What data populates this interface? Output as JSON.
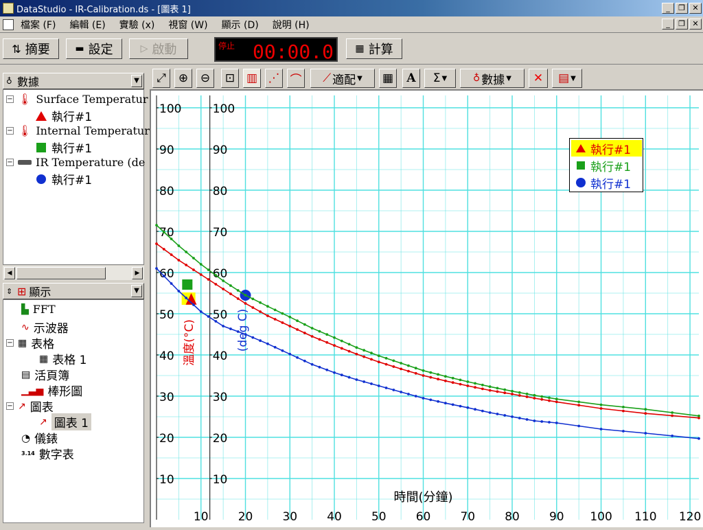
{
  "window": {
    "title": "DataStudio - IR-Calibration.ds - [圖表 1]"
  },
  "menu": {
    "items": [
      "檔案 (F)",
      "編輯 (E)",
      "實驗 (x)",
      "視窗 (W)",
      "顯示 (D)",
      "說明 (H)"
    ]
  },
  "toolbar": {
    "summary": "摘要",
    "setup": "設定",
    "start": "啟動",
    "status": "停止",
    "time": "00:00.0",
    "calculate": "計算"
  },
  "data_panel": {
    "header": "數據",
    "items": [
      {
        "label": "Surface Temperatur",
        "run": "執行#1"
      },
      {
        "label": "Internal Temperatur",
        "run": "執行#1"
      },
      {
        "label": "IR Temperature (de",
        "run": "執行#1"
      }
    ]
  },
  "display_panel": {
    "header": "顯示",
    "items": [
      "FFT",
      "示波器",
      "表格",
      "表格 1",
      "活頁簿",
      "棒形圖",
      "圖表",
      "圖表 1",
      "儀錶",
      "數字表"
    ],
    "digit_icon_text": "3.14"
  },
  "graph_toolbar": {
    "fit": "適配",
    "data": "數據",
    "text_tool": "A",
    "sigma": "Σ"
  },
  "colors": {
    "red": "#e00000",
    "green": "#1aa01a",
    "blue": "#1030d0",
    "grid": "#4fe0e0"
  },
  "chart_data": {
    "type": "line",
    "xlabel": "時間(分鐘)",
    "ylabel_left": "溫度(°C)",
    "ylabel_right": "(deg C)",
    "xlim": [
      0,
      122
    ],
    "ylim": [
      0,
      103
    ],
    "x_ticks": [
      10,
      20,
      30,
      40,
      50,
      60,
      70,
      80,
      90,
      100,
      110,
      120
    ],
    "y_ticks": [
      10,
      20,
      30,
      40,
      50,
      60,
      70,
      80,
      90,
      100
    ],
    "grid": true,
    "legend_placement": "top-right",
    "series": [
      {
        "name": "執行#1",
        "color": "#e00000",
        "marker": "triangle",
        "x": [
          0,
          5,
          10,
          15,
          20,
          25,
          30,
          35,
          40,
          45,
          50,
          55,
          60,
          65,
          70,
          75,
          80,
          85,
          90,
          100,
          110,
          122
        ],
        "y": [
          67,
          63,
          59.5,
          56,
          52.5,
          49.5,
          47,
          44.5,
          42.3,
          40.2,
          38.3,
          36.6,
          35,
          33.7,
          32.5,
          31.4,
          30.5,
          29.5,
          28.6,
          27,
          25.8,
          24.7
        ]
      },
      {
        "name": "執行#1",
        "color": "#1aa01a",
        "marker": "square",
        "x": [
          0,
          5,
          10,
          15,
          20,
          25,
          30,
          35,
          40,
          45,
          50,
          55,
          60,
          65,
          70,
          75,
          80,
          85,
          90,
          100,
          110,
          122
        ],
        "y": [
          71.5,
          66.5,
          62,
          58,
          54.5,
          51.8,
          49.2,
          46.5,
          44.2,
          41.8,
          39.8,
          38,
          36.2,
          34.8,
          33.5,
          32.3,
          31.2,
          30.2,
          29.3,
          27.9,
          26.8,
          25.2
        ]
      },
      {
        "name": "執行#1",
        "color": "#1030d0",
        "marker": "circle",
        "x": [
          0,
          5,
          10,
          15,
          20,
          25,
          30,
          35,
          40,
          45,
          50,
          55,
          60,
          65,
          70,
          75,
          80,
          85,
          90,
          100,
          110,
          122
        ],
        "y": [
          61,
          55.5,
          50.5,
          47,
          45,
          42.7,
          40.2,
          37.7,
          35.7,
          34,
          32.5,
          31,
          29.5,
          28.3,
          27.2,
          26,
          25,
          24,
          23.5,
          22,
          21,
          19.7
        ]
      }
    ],
    "y_axis_title_markers": [
      {
        "color": "#1aa01a",
        "shape": "square"
      },
      {
        "color": "#e00000",
        "shape": "triangle"
      },
      {
        "color": "#1030d0",
        "shape": "circle"
      }
    ]
  }
}
